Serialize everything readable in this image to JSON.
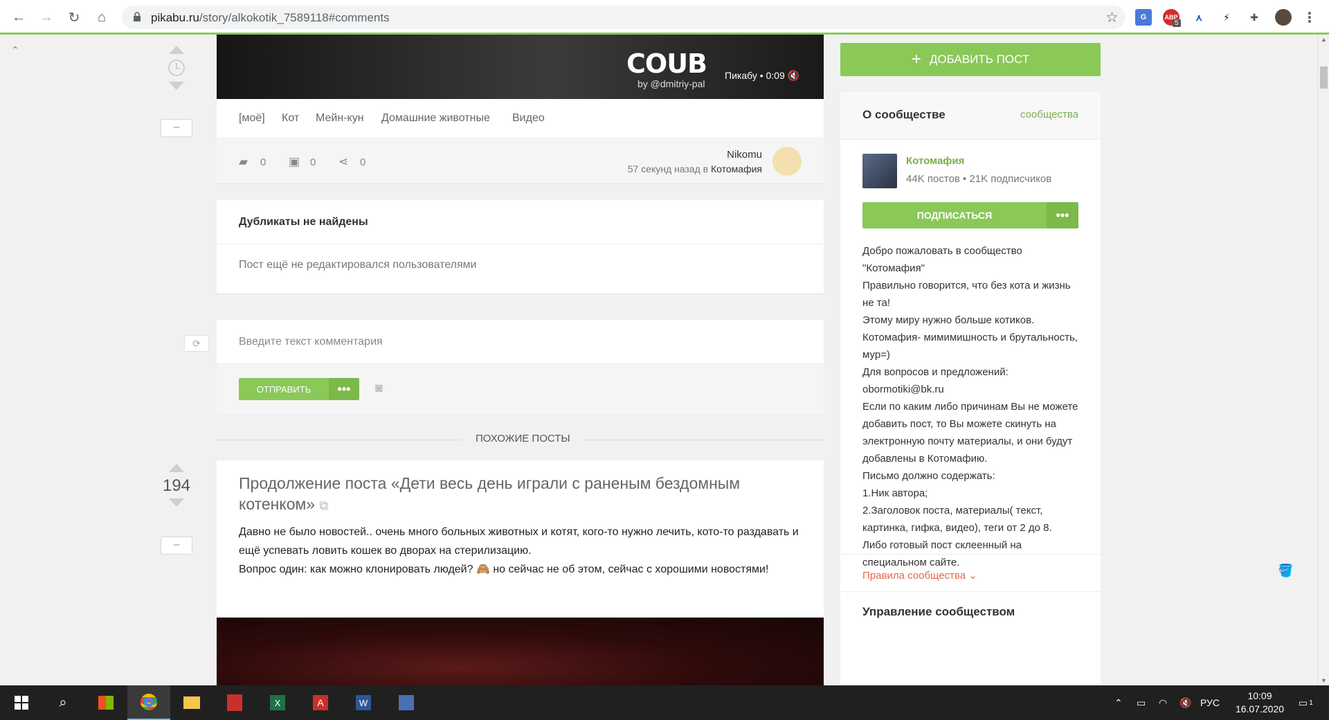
{
  "browser": {
    "url_domain": "pikabu.ru",
    "url_path": "/story/alkokotik_7589118#comments",
    "ext_abp_badge": "5"
  },
  "video": {
    "logo": "COUB",
    "by": "by @dmitriy-pal",
    "meta": "Пикабу • 0:09"
  },
  "post": {
    "tags": [
      "[моё]",
      "Кот",
      "Мейн-кун",
      "Домашние животные",
      "Видео"
    ],
    "comments_count": "0",
    "saves_count": "0",
    "shares_count": "0",
    "author": "Nikomu",
    "time": "57 секунд назад в",
    "community": "Котомафия"
  },
  "duplicates": {
    "title": "Дубликаты не найдены",
    "text": "Пост ещё не редактировался пользователями"
  },
  "comment_form": {
    "placeholder": "Введите текст комментария",
    "send_label": "ОТПРАВИТЬ",
    "more_label": "•••"
  },
  "similar": {
    "label": "ПОХОЖИЕ ПОСТЫ"
  },
  "post2": {
    "rating": "194",
    "title": "Продолжение поста «Дети весь день играли с раненым бездомным котенком»",
    "body_line1": "Давно не было новостей.. очень много больных животных и котят, кого-то нужно лечить, кото-то раздавать и ещё успевать ловить кошек во дворах на стерилизацию.",
    "body_line2": "Вопрос один: как можно клонировать людей? 🙈 но сейчас не об этом, сейчас с хорошими новостями!"
  },
  "sidebar": {
    "add_post": "ДОБАВИТЬ ПОСТ",
    "about_title": "О сообществе",
    "communities_link": "сообщества",
    "community_name": "Котомафия",
    "community_stats": "44K постов • 21K подписчиков",
    "subscribe_label": "ПОДПИСАТЬСЯ",
    "subscribe_more": "•••",
    "description": "Добро пожаловать в сообщество \"Котомафия\"\nПравильно говорится, что без кота и жизнь не та!\nЭтому миру нужно больше котиков.\nКотомафия- мимимишность и брутальность, мур=)\nДля вопросов и предложений: obormotiki@bk.ru\nЕсли по каким либо причинам Вы не можете добавить пост, то Вы можете скинуть на электронную почту материалы, и они будут добавлены в Котомафию.\nПисьмо должно содержать:\n1.Ник автора;\n2.Заголовок поста, материалы( текст, картинка, гифка, видео), теги от 2 до 8.\nЛибо готовый пост склеенный на специальном сайте.",
    "rules_link": "Правила сообщества ⌄",
    "manage_title": "Управление сообществом"
  },
  "taskbar": {
    "lang": "РУС",
    "time": "10:09",
    "date": "16.07.2020",
    "notif_count": "1"
  },
  "colors": {
    "accent_green": "#8ac858",
    "link_green": "#7aaf4c",
    "rules_red": "#e8674a"
  }
}
